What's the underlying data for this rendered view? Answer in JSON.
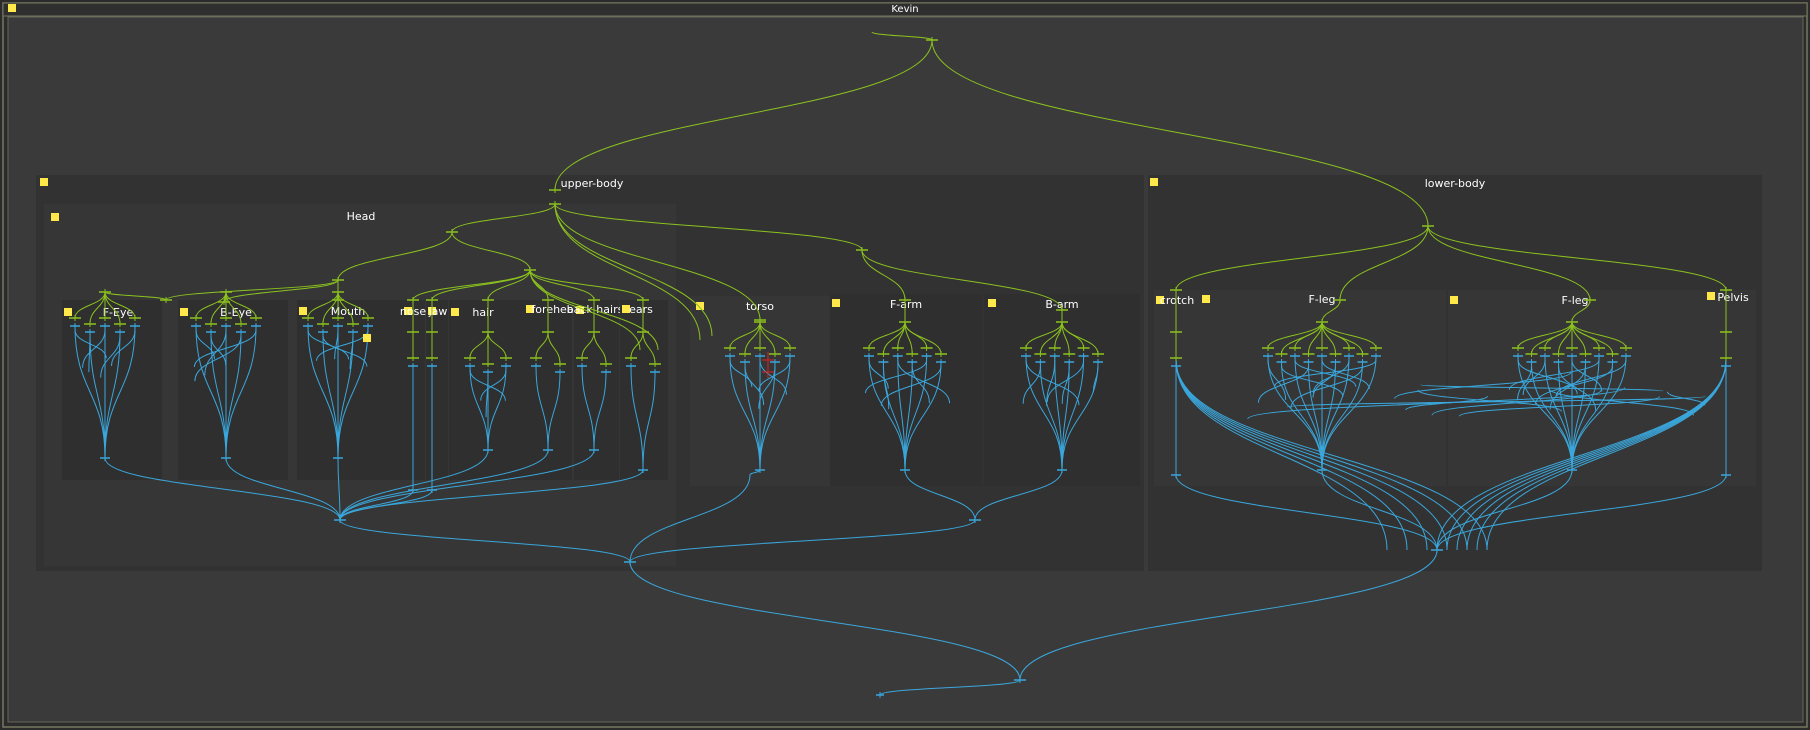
{
  "window": {
    "title": "Kevin"
  },
  "groups": {
    "upper_body": "upper-body",
    "lower_body": "lower-body",
    "head": "Head",
    "f_eye": "F-Eye",
    "b_eye": "B-Eye",
    "mouth": "Mouth",
    "nose": "nose",
    "jaw": "jaw",
    "hair": "hair",
    "forehead_hairs": "forehead",
    "back_hairs": "back hairs",
    "ears": "ears",
    "torso": "torso",
    "f_arm": "F-arm",
    "b_arm": "B-arm",
    "crotch": "crotch",
    "f_leg_1": "F-leg",
    "f_leg_2": "F-leg",
    "pelvis": "Pelvis"
  },
  "colors": {
    "background": "#2b2b2b",
    "frame_bg": "#3a3a3a",
    "group_bg": "#323232",
    "group_bg_inner": "#373737",
    "handle": "#ffe94a",
    "green_wire": "#8bc21e",
    "blue_wire": "#3aa7dc",
    "red_wire": "#e02020",
    "border": "#6a6a5a"
  }
}
